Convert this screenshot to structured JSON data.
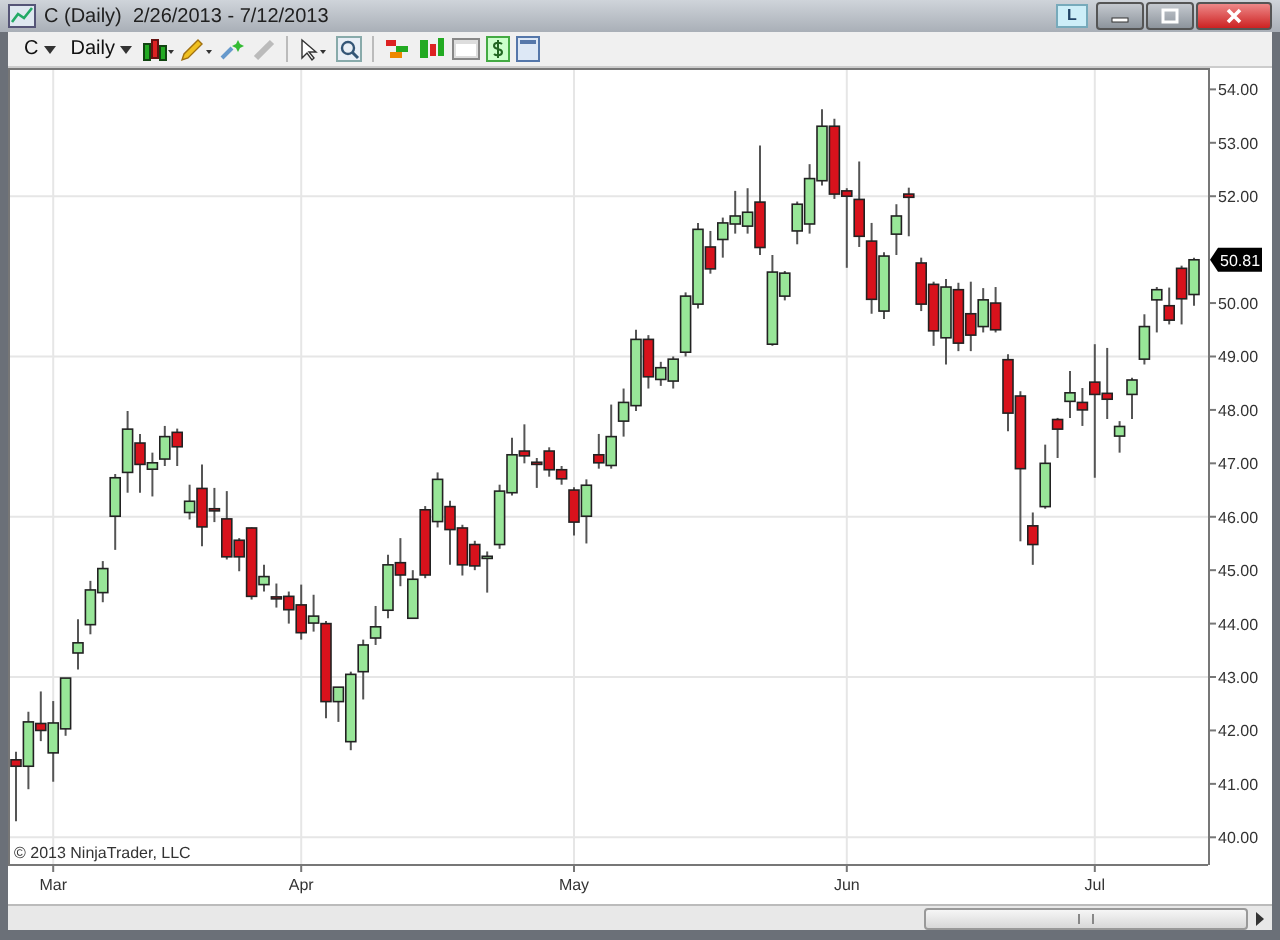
{
  "window": {
    "title": "C (Daily)  2/26/2013 - 7/12/2013",
    "badge": "L"
  },
  "toolbar": {
    "instrument": "C",
    "interval": "Daily"
  },
  "chart": {
    "copyright": "© 2013 NinjaTrader, LLC",
    "price_tag": "50.81",
    "chart_data": {
      "type": "candlestick",
      "grid": true,
      "ylim": [
        39.5,
        54.4
      ],
      "categories": [
        null,
        null,
        null,
        "Mar",
        null,
        null,
        null,
        null,
        null,
        null,
        null,
        null,
        null,
        null,
        null,
        null,
        null,
        null,
        null,
        null,
        null,
        null,
        null,
        "Apr",
        null,
        null,
        null,
        null,
        null,
        null,
        null,
        null,
        null,
        null,
        null,
        null,
        null,
        null,
        null,
        null,
        null,
        null,
        null,
        null,
        null,
        "May",
        null,
        null,
        null,
        null,
        null,
        null,
        null,
        null,
        null,
        null,
        null,
        null,
        null,
        null,
        null,
        null,
        null,
        null,
        null,
        null,
        null,
        "Jun",
        null,
        null,
        null,
        null,
        null,
        null,
        null,
        null,
        null,
        null,
        null,
        null,
        null,
        null,
        null,
        null,
        null,
        null,
        null,
        "Jul",
        null,
        null,
        null,
        null,
        null,
        null,
        null,
        null
      ],
      "yticks": [
        {
          "value": 40,
          "label": "40.00"
        },
        {
          "value": 41,
          "label": "41.00"
        },
        {
          "value": 42,
          "label": "42.00"
        },
        {
          "value": 43,
          "label": "43.00"
        },
        {
          "value": 44,
          "label": "44.00"
        },
        {
          "value": 45,
          "label": "45.00"
        },
        {
          "value": 46,
          "label": "46.00"
        },
        {
          "value": 47,
          "label": "47.00"
        },
        {
          "value": 48,
          "label": "48.00"
        },
        {
          "value": 49,
          "label": "49.00"
        },
        {
          "value": 50,
          "label": "50.00"
        },
        {
          "value": 52,
          "label": "52.00"
        },
        {
          "value": 53,
          "label": "53.00"
        },
        {
          "value": 54,
          "label": "54.00"
        }
      ],
      "ohlc": [
        [
          41.45,
          41.6,
          40.3,
          41.33
        ],
        [
          41.33,
          42.35,
          40.9,
          42.16
        ],
        [
          42.13,
          42.73,
          41.8,
          42.0
        ],
        [
          41.58,
          42.55,
          41.04,
          42.14
        ],
        [
          42.03,
          42.98,
          41.9,
          42.98
        ],
        [
          43.45,
          44.08,
          43.14,
          43.64
        ],
        [
          43.98,
          44.8,
          43.8,
          44.63
        ],
        [
          44.58,
          45.17,
          44.4,
          45.03
        ],
        [
          46.01,
          46.8,
          45.38,
          46.73
        ],
        [
          46.83,
          47.98,
          46.45,
          47.64
        ],
        [
          47.38,
          47.55,
          46.45,
          46.98
        ],
        [
          46.89,
          47.2,
          46.38,
          47.01
        ],
        [
          47.08,
          47.7,
          46.95,
          47.5
        ],
        [
          47.58,
          47.65,
          46.95,
          47.31
        ],
        [
          46.08,
          46.6,
          45.95,
          46.29
        ],
        [
          46.53,
          46.98,
          45.45,
          45.81
        ],
        [
          46.15,
          46.54,
          45.9,
          46.11
        ],
        [
          45.96,
          46.48,
          45.2,
          45.25
        ],
        [
          45.56,
          45.6,
          44.98,
          45.25
        ],
        [
          45.79,
          45.8,
          44.45,
          44.51
        ],
        [
          44.73,
          45.1,
          44.6,
          44.88
        ],
        [
          44.5,
          44.75,
          44.3,
          44.48
        ],
        [
          44.51,
          44.6,
          44.0,
          44.26
        ],
        [
          44.35,
          44.73,
          43.7,
          43.83
        ],
        [
          44.01,
          44.54,
          43.85,
          44.14
        ],
        [
          44.0,
          44.05,
          42.23,
          42.54
        ],
        [
          42.54,
          42.81,
          42.16,
          42.81
        ],
        [
          41.79,
          43.1,
          41.63,
          43.05
        ],
        [
          43.1,
          43.7,
          42.58,
          43.6
        ],
        [
          43.73,
          44.33,
          43.6,
          43.94
        ],
        [
          44.25,
          45.29,
          44.1,
          45.1
        ],
        [
          45.14,
          45.6,
          44.7,
          44.91
        ],
        [
          44.1,
          45.0,
          44.1,
          44.83
        ],
        [
          46.13,
          46.2,
          44.85,
          44.91
        ],
        [
          45.91,
          46.83,
          45.8,
          46.7
        ],
        [
          46.19,
          46.3,
          45.1,
          45.76
        ],
        [
          45.79,
          45.85,
          44.9,
          45.1
        ],
        [
          45.48,
          45.55,
          45.0,
          45.08
        ],
        [
          45.22,
          45.35,
          44.58,
          45.26
        ],
        [
          45.48,
          46.6,
          45.4,
          46.48
        ],
        [
          46.45,
          47.48,
          46.4,
          47.16
        ],
        [
          47.23,
          47.73,
          47.0,
          47.14
        ],
        [
          47.02,
          47.1,
          46.54,
          46.98
        ],
        [
          47.23,
          47.3,
          46.75,
          46.88
        ],
        [
          46.88,
          46.95,
          46.6,
          46.71
        ],
        [
          46.5,
          46.55,
          45.65,
          45.9
        ],
        [
          46.01,
          46.7,
          45.5,
          46.59
        ],
        [
          47.16,
          47.55,
          46.9,
          47.01
        ],
        [
          46.96,
          48.1,
          46.9,
          47.5
        ],
        [
          47.79,
          48.4,
          47.5,
          48.14
        ],
        [
          48.08,
          49.5,
          47.98,
          49.32
        ],
        [
          49.32,
          49.4,
          48.4,
          48.62
        ],
        [
          48.57,
          48.9,
          48.45,
          48.79
        ],
        [
          48.54,
          49.0,
          48.4,
          48.95
        ],
        [
          49.08,
          50.2,
          49.0,
          50.13
        ],
        [
          49.98,
          51.5,
          49.9,
          51.38
        ],
        [
          51.05,
          51.35,
          50.55,
          50.64
        ],
        [
          51.19,
          51.6,
          50.85,
          51.5
        ],
        [
          51.48,
          52.1,
          51.3,
          51.63
        ],
        [
          51.44,
          52.15,
          51.3,
          51.7
        ],
        [
          51.89,
          52.95,
          50.9,
          51.04
        ],
        [
          49.23,
          50.9,
          49.2,
          50.58
        ],
        [
          50.13,
          50.6,
          50.05,
          50.56
        ],
        [
          51.35,
          51.9,
          51.1,
          51.85
        ],
        [
          51.48,
          52.6,
          51.3,
          52.33
        ],
        [
          52.29,
          53.63,
          52.2,
          53.31
        ],
        [
          53.31,
          53.45,
          51.95,
          52.04
        ],
        [
          52.1,
          52.15,
          50.66,
          52.0
        ],
        [
          51.94,
          52.65,
          51.05,
          51.25
        ],
        [
          51.16,
          51.5,
          49.8,
          50.07
        ],
        [
          49.85,
          50.95,
          49.7,
          50.88
        ],
        [
          51.29,
          51.85,
          50.9,
          51.63
        ],
        [
          52.04,
          52.16,
          51.25,
          51.98
        ],
        [
          50.75,
          50.85,
          49.85,
          49.98
        ],
        [
          50.35,
          50.4,
          49.2,
          49.48
        ],
        [
          49.35,
          50.45,
          48.85,
          50.3
        ],
        [
          50.25,
          50.38,
          49.1,
          49.25
        ],
        [
          49.8,
          50.4,
          49.1,
          49.4
        ],
        [
          49.56,
          50.28,
          49.45,
          50.06
        ],
        [
          50.0,
          50.3,
          49.45,
          49.5
        ],
        [
          48.94,
          49.04,
          47.6,
          47.94
        ],
        [
          48.26,
          48.35,
          45.54,
          46.9
        ],
        [
          45.83,
          46.08,
          45.1,
          45.48
        ],
        [
          46.19,
          47.35,
          46.15,
          47.0
        ],
        [
          47.82,
          47.85,
          47.1,
          47.64
        ],
        [
          48.16,
          48.73,
          47.85,
          48.32
        ],
        [
          48.14,
          48.41,
          47.7,
          48.0
        ],
        [
          48.52,
          49.23,
          46.73,
          48.29
        ],
        [
          48.31,
          49.16,
          47.83,
          48.2
        ],
        [
          47.51,
          47.79,
          47.2,
          47.69
        ],
        [
          48.29,
          48.6,
          47.83,
          48.56
        ],
        [
          48.95,
          49.79,
          48.85,
          49.56
        ],
        [
          50.06,
          50.3,
          49.45,
          50.25
        ],
        [
          49.95,
          50.29,
          49.6,
          49.68
        ],
        [
          50.65,
          50.7,
          49.6,
          50.08
        ],
        [
          50.16,
          50.85,
          49.95,
          50.81
        ]
      ]
    }
  }
}
